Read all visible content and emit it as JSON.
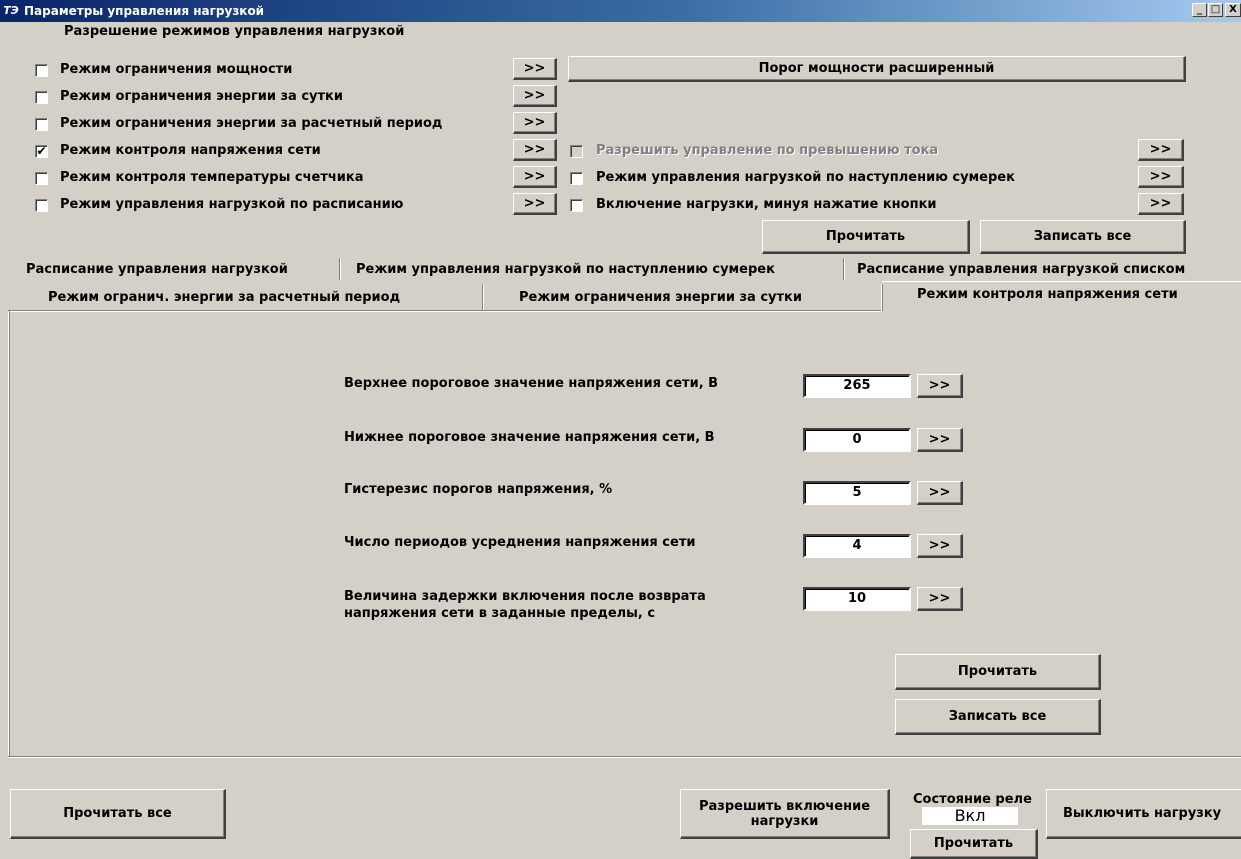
{
  "window": {
    "title": "Параметры управления нагрузкой",
    "icon_text": "ТЭ",
    "minimize": "_",
    "maximize": "□",
    "close": "X"
  },
  "modes": {
    "heading": "Разрешение режимов управления нагрузкой",
    "items": [
      {
        "label": "Режим ограничения мощности",
        "checked": false
      },
      {
        "label": "Режим ограничения энергии за сутки",
        "checked": false
      },
      {
        "label": "Режим ограничения энергии за расчетный период",
        "checked": false
      },
      {
        "label": "Режим контроля напряжения сети",
        "checked": true
      },
      {
        "label": "Режим контроля температуры счетчика",
        "checked": false
      },
      {
        "label": "Режим управления нагрузкой по расписанию",
        "checked": false
      }
    ],
    "arrow_label": ">>",
    "check_mark": "✔"
  },
  "right_options": {
    "power_threshold_button": "Порог мощности расширенный",
    "items": [
      {
        "label": "Разрешить управление по превышению тока",
        "checked": false,
        "disabled": true
      },
      {
        "label": "Режим управления нагрузкой по наступлению сумерек",
        "checked": false,
        "disabled": false
      },
      {
        "label": "Включение нагрузки, минуя нажатие кнопки",
        "checked": false,
        "disabled": false
      }
    ],
    "read_button": "Прочитать",
    "write_all_button": "Записать все"
  },
  "tabs": {
    "row1": [
      "Расписание управления нагрузкой",
      "Режим управления нагрузкой по наступлению сумерек",
      "Расписание управления нагрузкой списком"
    ],
    "row2": [
      "Режим огранич. энергии за расчетный период",
      "Режим ограничения энергии за сутки",
      "Режим контроля напряжения сети"
    ],
    "active": "Режим контроля напряжения сети"
  },
  "voltage_panel": {
    "rows": [
      {
        "label": "Верхнее пороговое значение напряжения сети, В",
        "value": "265"
      },
      {
        "label": "Нижнее пороговое значение напряжения сети, В",
        "value": "0"
      },
      {
        "label": "Гистерезис порогов напряжения, %",
        "value": "5"
      },
      {
        "label": "Число периодов усреднения напряжения сети",
        "value": "4"
      },
      {
        "label": "Величина задержки включения после возврата\nнапряжения сети в заданные пределы, с",
        "value": "10"
      }
    ],
    "read_button": "Прочитать",
    "write_all_button": "Записать все"
  },
  "bottom": {
    "read_all_button": "Прочитать все",
    "allow_load_button": "Разрешить включение\nнагрузки",
    "relay_state_label": "Состояние реле",
    "relay_state_value": "Вкл",
    "relay_read_button": "Прочитать",
    "disconnect_button": "Выключить нагрузку"
  }
}
